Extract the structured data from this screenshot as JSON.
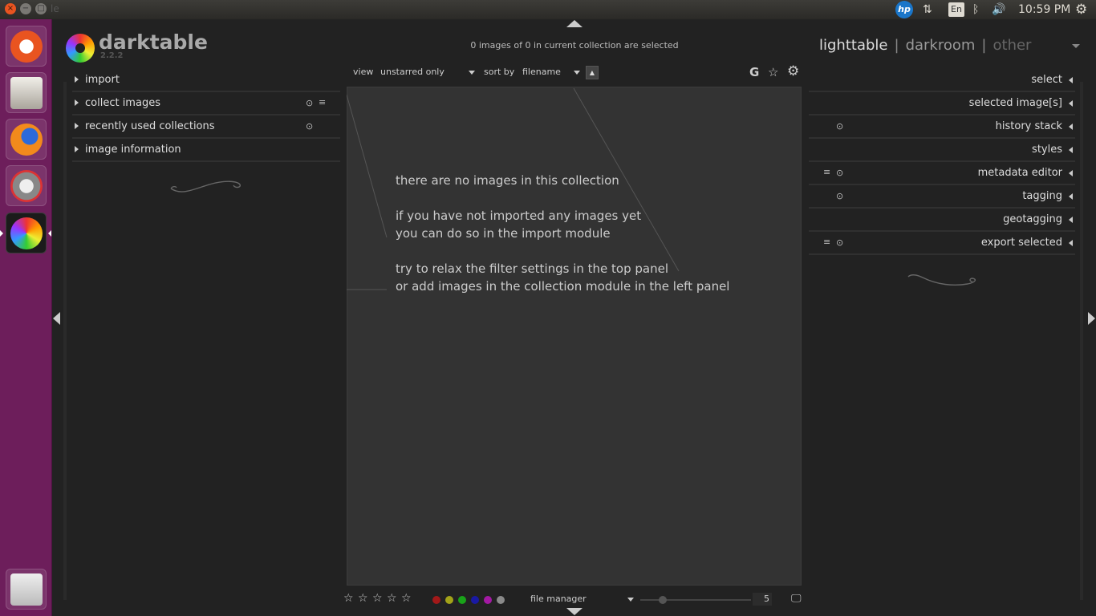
{
  "window": {
    "close": "×",
    "minimize": "−",
    "maximize": "□",
    "title_fragment": "le"
  },
  "tray": {
    "hp": "hp",
    "network": "⇅",
    "language": "En",
    "bluetooth": "ᛒ",
    "volume": "🔊",
    "clock": "10:59 PM",
    "gear": "⚙"
  },
  "launcher": [
    "ubuntu-logo-icon",
    "files-icon",
    "firefox-icon",
    "system-tools-icon",
    "darktable-icon",
    "trash-icon"
  ],
  "app": {
    "name": "darktable",
    "version": "2.2.2",
    "selection_status": "0 images of 0 in current collection are selected",
    "views": {
      "lighttable": "lighttable",
      "sep": "|",
      "darkroom": "darkroom",
      "other": "other"
    }
  },
  "filter_bar": {
    "view_label": "view",
    "view_value": "unstarred only",
    "sort_label": "sort by",
    "sort_value": "filename",
    "order_icon": "▲",
    "grouping_icon": "G",
    "overlay_icon": "☆",
    "prefs_icon": "⚙"
  },
  "left_modules": [
    {
      "label": "import",
      "b1": "",
      "b2": ""
    },
    {
      "label": "collect images",
      "b1": "⊙",
      "b2": "≡"
    },
    {
      "label": "recently used collections",
      "b1": "⊙",
      "b2": ""
    },
    {
      "label": "image information",
      "b1": "",
      "b2": ""
    }
  ],
  "right_modules": [
    {
      "label": "select",
      "b1": "",
      "b2": ""
    },
    {
      "label": "selected image[s]",
      "b1": "",
      "b2": ""
    },
    {
      "label": "history stack",
      "b1": "⊙",
      "b2": ""
    },
    {
      "label": "styles",
      "b1": "",
      "b2": ""
    },
    {
      "label": "metadata editor",
      "b1": "⊙",
      "b2": "≡"
    },
    {
      "label": "tagging",
      "b1": "⊙",
      "b2": ""
    },
    {
      "label": "geotagging",
      "b1": "",
      "b2": ""
    },
    {
      "label": "export selected",
      "b1": "⊙",
      "b2": "≡"
    }
  ],
  "empty_message": {
    "line1": "there are no images in this collection",
    "line2": "if you have not imported any images yet",
    "line3": "you can do so in the import module",
    "line4": "try to relax the filter settings in the top panel",
    "line5": "or add images in the collection module in the left panel"
  },
  "bottom_bar": {
    "stars": [
      "☆",
      "☆",
      "☆",
      "☆",
      "☆"
    ],
    "color_labels": [
      "#a31919",
      "#a3a319",
      "#19a319",
      "#1919a3",
      "#a319a3",
      "#8a8a8a"
    ],
    "layout_label": "file manager",
    "zoom_value": "5",
    "display_icon": "🖵"
  },
  "colors": {
    "launcher_bg": "#6d1e5b",
    "panel_bg": "#222222",
    "center_bg": "#333333"
  }
}
